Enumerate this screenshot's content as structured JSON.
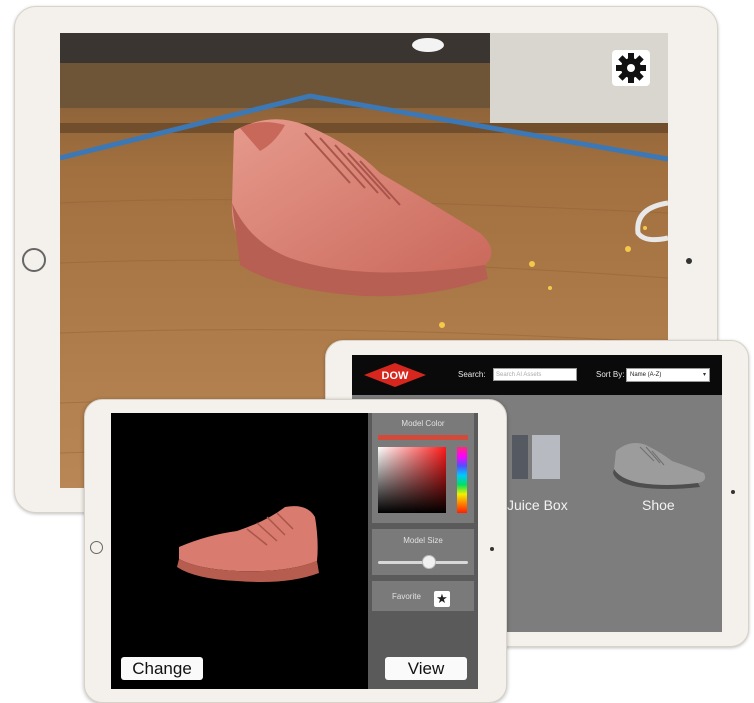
{
  "ar_view": {
    "settings_icon": "gear-icon"
  },
  "catalog": {
    "logo_text": "DOW",
    "search_label": "Search:",
    "search_placeholder": "Search AI Assets",
    "sort_label": "Sort By:",
    "sort_value": "Name (A-Z)",
    "items": [
      {
        "label": "Juice Box"
      },
      {
        "label": "Shoe"
      }
    ]
  },
  "editor": {
    "model_color_title": "Model Color",
    "model_size_title": "Model Size",
    "model_size_level": 0.55,
    "favorite_label": "Favorite",
    "favorite_icon": "star-icon",
    "change_label": "Change",
    "view_label": "View",
    "shoe_color": "#d97b6f"
  }
}
